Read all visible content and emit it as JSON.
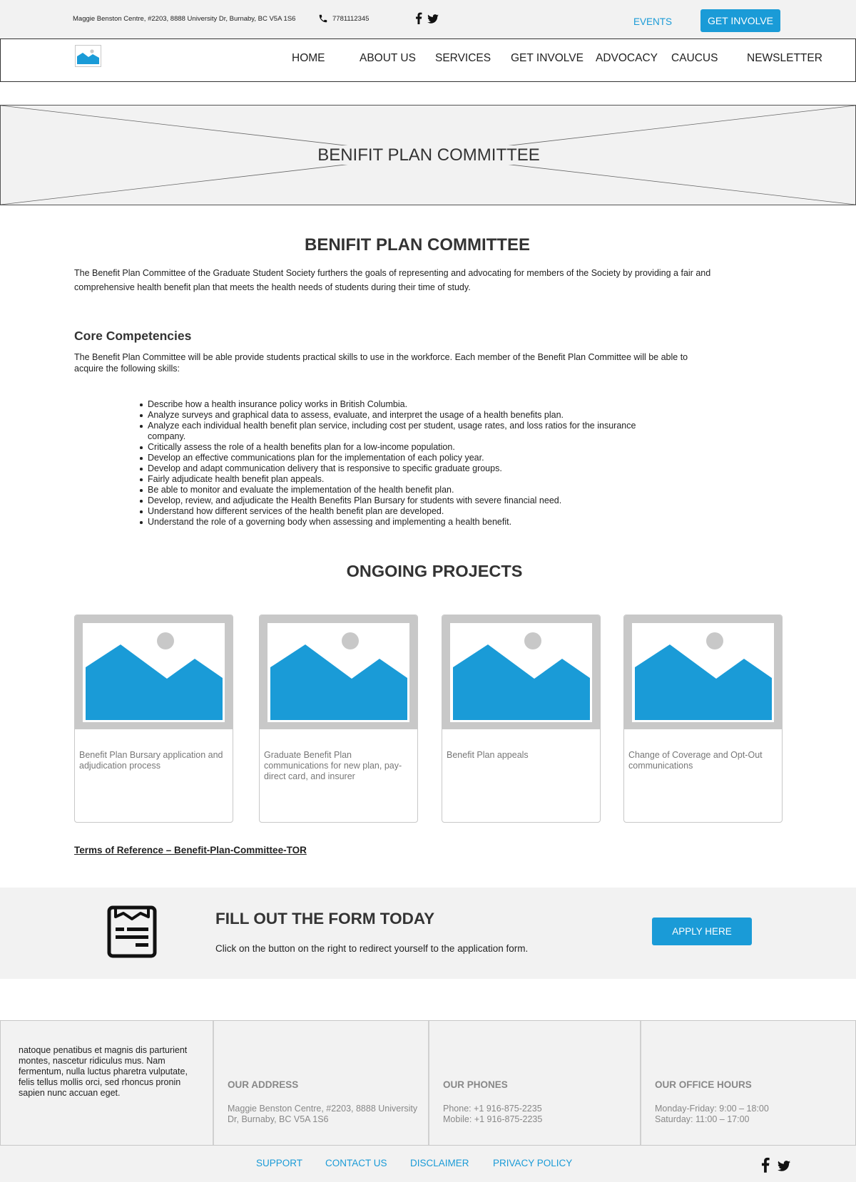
{
  "topbar": {
    "address": "Maggie Benston Centre, #2203, 8888 University Dr, Burnaby, BC V5A 1S6",
    "phone": "7781112345",
    "events_label": "EVENTS",
    "get_involve_label": "GET INVOLVE"
  },
  "nav": {
    "items": [
      {
        "label": "HOME"
      },
      {
        "label": "ABOUT US"
      },
      {
        "label": "SERVICES"
      },
      {
        "label": "GET INVOLVE"
      },
      {
        "label": "ADVOCACY"
      },
      {
        "label": "CAUCUS"
      },
      {
        "label": "NEWSLETTER"
      }
    ]
  },
  "hero": {
    "title": "BENIFIT PLAN COMMITTEE"
  },
  "main": {
    "title": "BENIFIT PLAN COMMITTEE",
    "intro": "The Benefit Plan Committee of the Graduate Student Society furthers the goals of representing and advocating for members of the Society by providing a fair and comprehensive health benefit plan that meets the health needs of students during their time of study.",
    "core_heading": "Core Competencies",
    "core_text": "The Benefit Plan Committee will be able provide students practical skills to use in the workforce. Each member of the Benefit Plan Committee will be able to acquire the following skills:",
    "skills": [
      "Describe how a health insurance policy works in British Columbia.",
      "Analyze surveys and graphical data to assess, evaluate, and interpret the usage of a health benefits plan.",
      "Analyze each individual health benefit plan service, including cost per student, usage rates, and loss ratios for the insurance company.",
      "Critically assess the role of a health benefits plan for a low-income population.",
      "Develop an effective communications plan for the implementation of each policy year.",
      "Develop and adapt communication delivery that is responsive to specific graduate groups.",
      "Fairly adjudicate health benefit plan appeals.",
      "Be able to monitor and evaluate the implementation of the health benefit plan.",
      "Develop, review, and adjudicate the Health Benefits Plan Bursary for students with severe financial need.",
      "Understand how different services of the health benefit plan are developed.",
      "Understand the role of a governing body when assessing and implementing a health benefit."
    ],
    "ongoing_heading": "ONGOING PROJECTS",
    "projects": [
      {
        "caption": "Benefit Plan Bursary application and adjudication process"
      },
      {
        "caption": "Graduate Benefit Plan communications for new plan, pay-direct card, and insurer"
      },
      {
        "caption": "Benefit Plan appeals"
      },
      {
        "caption": "Change of Coverage and Opt-Out communications"
      }
    ],
    "tor_link": "Terms of Reference – Benefit-Plan-Committee-TOR"
  },
  "form_band": {
    "title": "FILL OUT THE FORM TODAY",
    "description": "Click on the button on the right to redirect yourself to the application form.",
    "apply_label": "APPLY HERE"
  },
  "footer": {
    "lorem": "natoque penatibus et magnis dis parturient montes, nascetur ridiculus mus. Nam fermentum, nulla luctus pharetra vulputate, felis tellus mollis orci, sed rhoncus pronin sapien nunc accuan eget.",
    "address_heading": "OUR ADDRESS",
    "address_text": "Maggie Benston Centre, #2203, 8888 University Dr, Burnaby, BC V5A 1S6",
    "phones_heading": "OUR PHONES",
    "phone_line": "Phone: +1 916-875-2235",
    "mobile_line": "Mobile: +1 916-875-2235",
    "hours_heading": "OUR OFFICE HOURS",
    "hours_weekday": "Monday-Friday: 9:00 – 18:00",
    "hours_saturday": "Saturday: 11:00 – 17:00"
  },
  "bottom_links": [
    {
      "label": "SUPPORT"
    },
    {
      "label": "CONTACT US"
    },
    {
      "label": "DISCLAIMER"
    },
    {
      "label": "PRIVACY POLICY"
    }
  ],
  "colors": {
    "accent": "#1a9bd7",
    "panel": "#f2f2f2",
    "placeholder_frame": "#c8c8c8"
  }
}
